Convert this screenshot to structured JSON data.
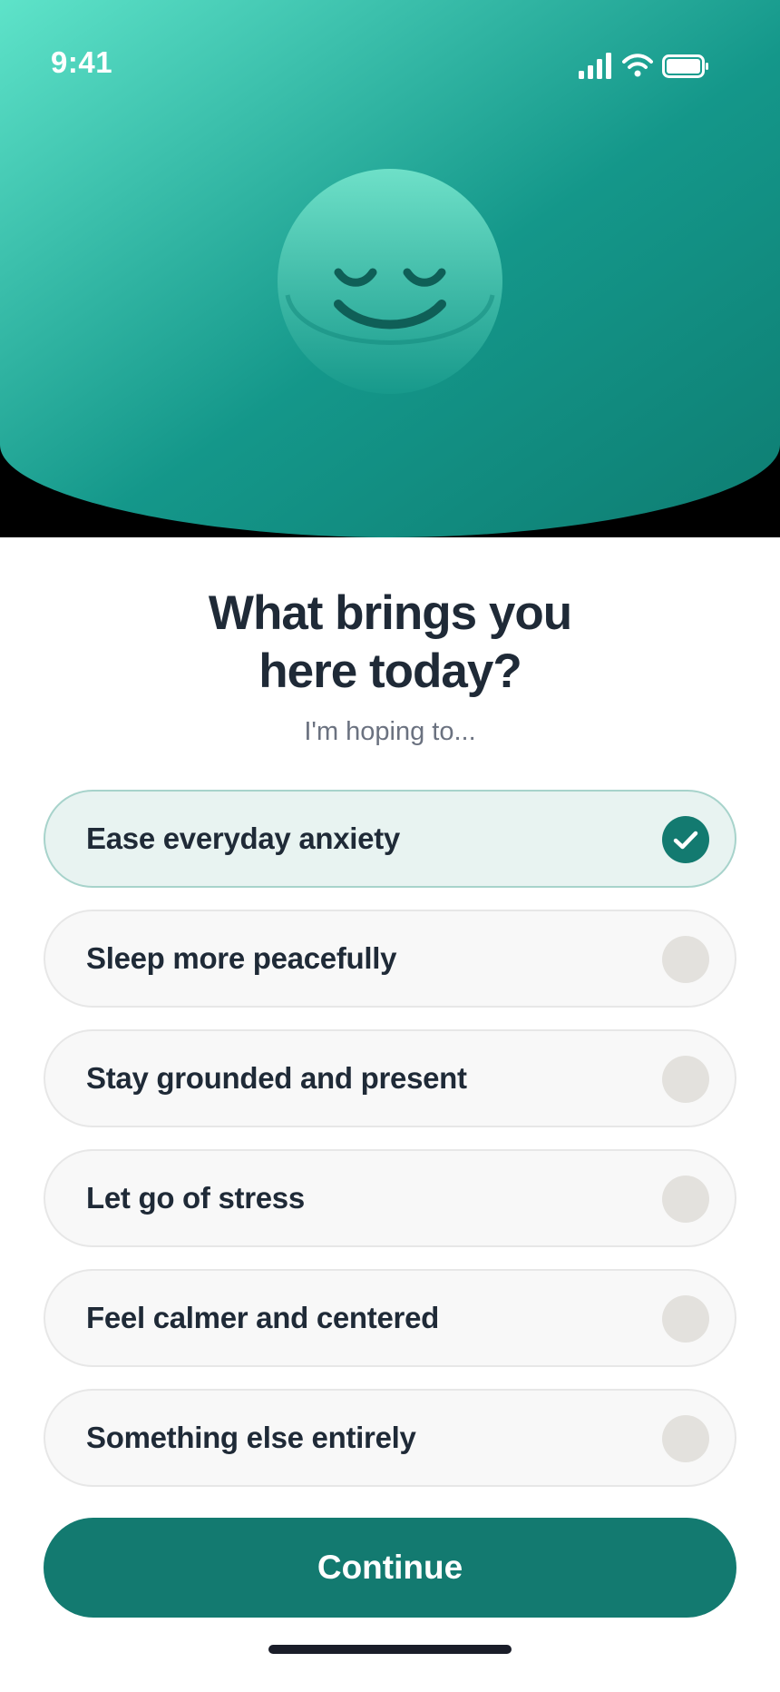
{
  "status_bar": {
    "time": "9:41",
    "icons": [
      "signal-icon",
      "wifi-icon",
      "battery-icon"
    ]
  },
  "hero": {
    "mascot": "smiling-face-icon",
    "gradient_start": "#5ee3c9",
    "gradient_end": "#0e7d72"
  },
  "question": {
    "title_line1": "What brings you",
    "title_line2": "here today?",
    "subtitle": "I'm hoping to..."
  },
  "options": [
    {
      "label": "Ease everyday anxiety",
      "selected": true
    },
    {
      "label": "Sleep more peacefully",
      "selected": false
    },
    {
      "label": "Stay grounded and present",
      "selected": false
    },
    {
      "label": "Let go of stress",
      "selected": false
    },
    {
      "label": "Feel calmer and centered",
      "selected": false
    },
    {
      "label": "Something else entirely",
      "selected": false
    }
  ],
  "actions": {
    "continue_label": "Continue"
  },
  "colors": {
    "accent": "#137a70",
    "selected_bg": "#e8f3f1",
    "unselected_bg": "#f8f8f8",
    "radio_off": "#e3e1dd",
    "text_dark": "#1f2a37",
    "text_muted": "#6b7280"
  }
}
